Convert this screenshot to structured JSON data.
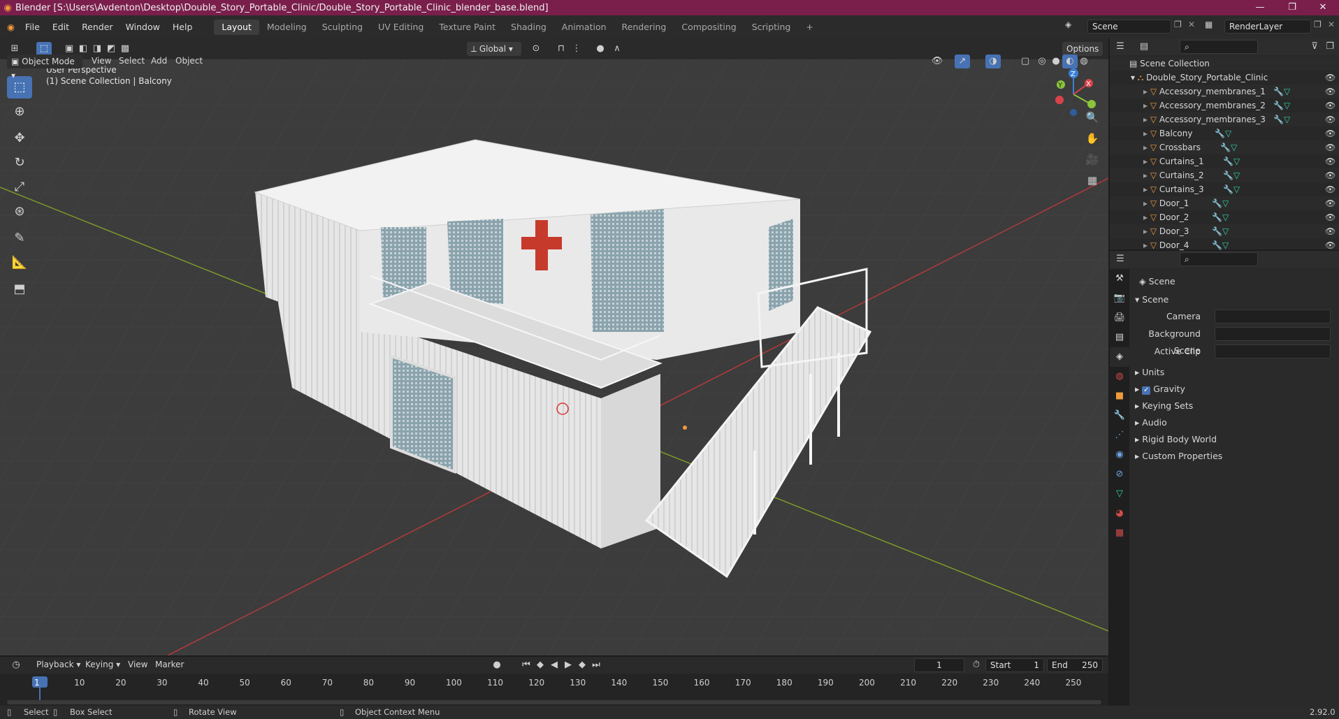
{
  "window": {
    "title": "Blender [S:\\Users\\Avdenton\\Desktop\\Double_Story_Portable_Clinic/Double_Story_Portable_Clinic_blender_base.blend]"
  },
  "menu": {
    "items": [
      "File",
      "Edit",
      "Render",
      "Window",
      "Help"
    ]
  },
  "workspaces": {
    "tabs": [
      "Layout",
      "Modeling",
      "Sculpting",
      "UV Editing",
      "Texture Paint",
      "Shading",
      "Animation",
      "Rendering",
      "Compositing",
      "Scripting"
    ],
    "active": "Layout",
    "add": "+"
  },
  "scene": {
    "name": "Scene",
    "render_layer": "RenderLayer"
  },
  "viewport_header": {
    "mode": "Object Mode",
    "menus": [
      "View",
      "Select",
      "Add",
      "Object"
    ],
    "transform": "Global",
    "options": "Options"
  },
  "viewport": {
    "perspective": "User Perspective",
    "collection_info": "(1) Scene Collection | Balcony",
    "gizmo": {
      "z": "Z",
      "y": "Y",
      "x": "X"
    }
  },
  "outliner": {
    "root": "Scene Collection",
    "collection": "Double_Story_Portable_Clinic",
    "objects": [
      "Accessory_membranes_1",
      "Accessory_membranes_2",
      "Accessory_membranes_3",
      "Balcony",
      "Crossbars",
      "Curtains_1",
      "Curtains_2",
      "Curtains_3",
      "Door_1",
      "Door_2",
      "Door_3",
      "Door_4"
    ]
  },
  "properties": {
    "context": "Scene",
    "section": "Scene",
    "fields": [
      {
        "label": "Camera",
        "value": ""
      },
      {
        "label": "Background Scene",
        "value": ""
      },
      {
        "label": "Active Clip",
        "value": ""
      }
    ],
    "panels": [
      "Units",
      "Gravity",
      "Keying Sets",
      "Audio",
      "Rigid Body World",
      "Custom Properties"
    ],
    "gravity_checked": true
  },
  "timeline": {
    "menus": [
      "Playback",
      "Keying",
      "View",
      "Marker"
    ],
    "current_frame": "1",
    "start_label": "Start",
    "start": "1",
    "end_label": "End",
    "end": "250",
    "ruler": [
      "1",
      "10",
      "20",
      "30",
      "40",
      "50",
      "60",
      "70",
      "80",
      "90",
      "100",
      "110",
      "120",
      "130",
      "140",
      "150",
      "160",
      "170",
      "180",
      "190",
      "200",
      "210",
      "220",
      "230",
      "240",
      "250"
    ]
  },
  "status": {
    "select": "Select",
    "box_select": "Box Select",
    "rotate": "Rotate View",
    "context_menu": "Object Context Menu",
    "version": "2.92.0"
  },
  "colors": {
    "title_bar": "#7a1f4c",
    "accent": "#4772b3",
    "object_orange": "#f09a3c"
  }
}
